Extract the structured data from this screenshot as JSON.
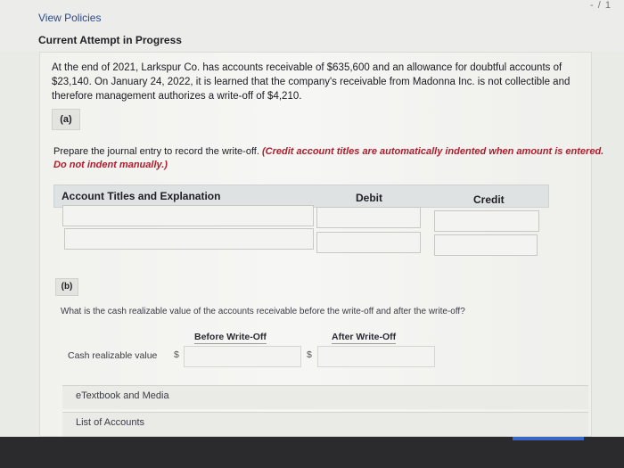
{
  "header": {
    "link_label": "View Policies",
    "attempt_label": "Current Attempt in Progress",
    "corner_mark": "- / 1"
  },
  "problem": {
    "text": "At the end of 2021, Larkspur Co. has accounts receivable of $635,600 and an allowance for doubtful accounts of $23,140. On January 24, 2022, it is learned that the company's receivable from Madonna Inc. is not collectible and therefore management authorizes a write-off of $4,210."
  },
  "part_a": {
    "label": "(a)",
    "instruction": "Prepare the journal entry to record the write-off.",
    "note": "(Credit account titles are automatically indented when amount is entered. Do not indent manually.)",
    "table": {
      "col_account": "Account Titles and Explanation",
      "col_debit": "Debit",
      "col_credit": "Credit"
    }
  },
  "part_b": {
    "label": "(b)",
    "question": "What is the cash realizable value of the accounts receivable before the write-off and after the write-off?",
    "col_before": "Before Write-Off",
    "col_after": "After Write-Off",
    "row_label": "Cash realizable value",
    "currency": "$"
  },
  "footer": {
    "etextbook": "eTextbook and Media",
    "accounts": "List of Accounts"
  }
}
